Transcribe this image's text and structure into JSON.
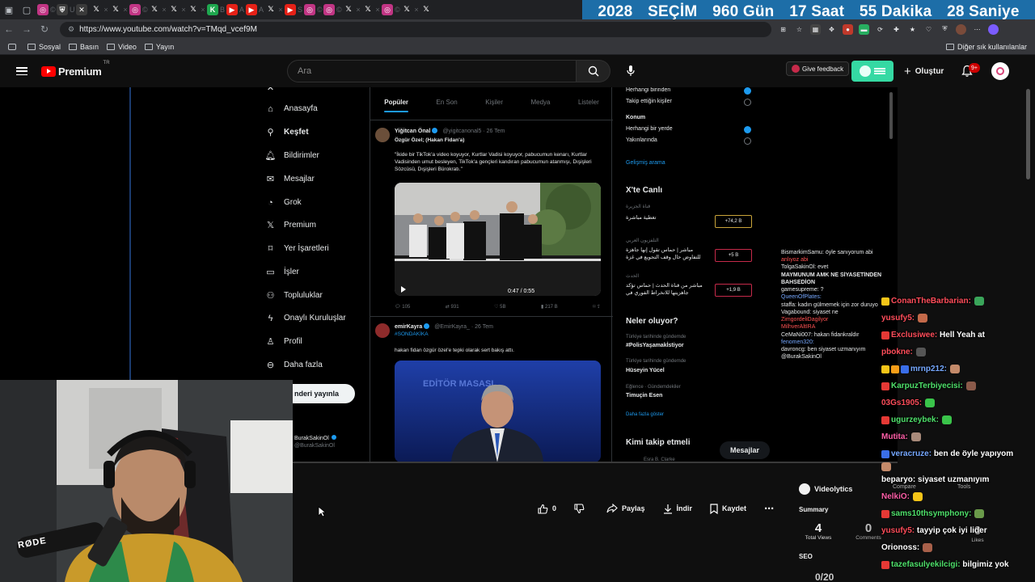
{
  "countdown": {
    "year": "2028",
    "label": "SEÇİM",
    "days": "960 Gün",
    "hours": "17 Saat",
    "minutes": "55 Dakika",
    "seconds": "28 Saniye",
    "bg_color": "#1d6ea8"
  },
  "browser": {
    "url": "https://www.youtube.com/watch?v=TMqd_vcef9M",
    "bookmarks": [
      "Sosyal",
      "Basın",
      "Video",
      "Yayın"
    ],
    "bookmarks_right": "Diğer sık kullanılanlar"
  },
  "youtube": {
    "logo_text": "Premium",
    "logo_region": "TR",
    "search_placeholder": "Ara",
    "feedback_label": "Give feedback",
    "create_label": "Oluştur",
    "notif_count": "9+",
    "accent": "#ff0000"
  },
  "x_screen": {
    "nav": [
      {
        "label": "Anasayfa",
        "icon": "home-icon"
      },
      {
        "label": "Keşfet",
        "icon": "search-icon",
        "bold": true
      },
      {
        "label": "Bildirimler",
        "icon": "bell-icon"
      },
      {
        "label": "Mesajlar",
        "icon": "mail-icon"
      },
      {
        "label": "Grok",
        "icon": "grok-icon"
      },
      {
        "label": "Premium",
        "icon": "x-logo-icon"
      },
      {
        "label": "Yer İşaretleri",
        "icon": "bookmark-icon"
      },
      {
        "label": "İşler",
        "icon": "briefcase-icon"
      },
      {
        "label": "Topluluklar",
        "icon": "people-icon"
      },
      {
        "label": "Onaylı Kuruluşlar",
        "icon": "lightning-icon"
      },
      {
        "label": "Profil",
        "icon": "person-icon"
      },
      {
        "label": "Daha fazla",
        "icon": "more-circle-icon"
      }
    ],
    "post_button": "nderi yayınla",
    "account_name": "BurakSakinOl",
    "account_handle": "@BurakSakinOl",
    "tabs": [
      "Popüler",
      "En Son",
      "Kişiler",
      "Medya",
      "Listeler"
    ],
    "tweet1": {
      "author": "Yiğitcan Önal",
      "meta": "@yigitcanonal5 · 26 Tem",
      "title": "Özgür Özel; (Hakan Fidan'a)",
      "text": "\"İkide bir TikTok'a video koyuyor, Kurtlar Vadisi koyuyor, pabucumun kenarı, Kurtlar Vadisinden umut besleyen, TikTok'a gençleri kandıran pabucumun atanmışı, Dışişleri Sözcüsü, Dışişleri Bürokratı.\"",
      "duration": "0:47 / 0:55",
      "stats": [
        "105",
        "931",
        "5B",
        "217 B"
      ]
    },
    "tweet2": {
      "author": "emirKayra",
      "meta": "@EmirKayra_ · 26 Tem",
      "hashtag": "#SONDAKİKA",
      "text": "hakan fidan özgür özel'e tepki olarak sert bakış attı.",
      "studio_label": "EDİTÖR MASASI"
    },
    "right": {
      "option1": "Herhangi birinden",
      "option2": "Takip ettiğin kişiler",
      "location_header": "Konum",
      "option3": "Herhangi bir yerde",
      "option4": "Yakınlarında",
      "advanced": "Gelişmiş arama",
      "live_header": "X'te Canlı",
      "live": [
        {
          "text": "تغطية مباشرة",
          "source": "قناة الجزيرة",
          "count": "+74,2 B"
        },
        {
          "text": "مباشر | حماس تقول إنها جاهزة للتفاوض حال وقف التجويع في غزة",
          "source": "التلفزيون العربي",
          "count": "+5 B"
        },
        {
          "text": "مباشر من قناة الحدث | حماس تؤكد جاهزيتها للانخراط الفوري في",
          "source": "الحدث",
          "count": "+1,9 B"
        }
      ],
      "whats_header": "Neler oluyor?",
      "trends": [
        {
          "ctx": "Türkiye tarihinde gündemde",
          "name": "#PolisYaşamakİstiyor"
        },
        {
          "ctx": "Türkiye tarihinde gündemde",
          "name": "Hüseyin Yücel"
        },
        {
          "ctx": "Eğlence · Gündemdekiler",
          "name": "Timuçin Esen"
        }
      ],
      "show_more": "Daha fazla göster",
      "follow_header": "Kimi takip etmeli",
      "follow_name": "Esra B. Clarke"
    },
    "messages_pill": "Mesajlar",
    "chat": [
      "BismarkimSamu: öyle sanıyorum abi",
      "anlıyoz abi",
      "TolgaSakinOl: evet",
      "MAYMUNUM AMK NE SİYASETİNDEN BAHSEDİON",
      "gamesupreme: ?",
      "QueenOfPlates:",
      "staffa: kadın gülmemek için zor duruyo",
      "Vagabound: siyaset ne",
      "ZimgordeliDagilyor",
      "MilhverAltIRA",
      "CeMaNi007: hakan fidankraldır",
      "fenomen320:",
      "davroncg: ben siyaset uzmanıyım",
      "@BurakSakinOl"
    ]
  },
  "video_actions": {
    "likes": "0",
    "share": "Paylaş",
    "download": "İndir",
    "save": "Kaydet"
  },
  "videolytics": {
    "title": "Videolytics",
    "summary": "Summary",
    "views_value": "4",
    "views_label": "Total Views",
    "comments_value": "0",
    "comments_label": "Comments",
    "likes_value": "0",
    "likes_label": "Likes",
    "seo": "SEO",
    "score": "0/20",
    "compare": "Compare",
    "tools": "Tools"
  },
  "stream_chat": [
    {
      "user": "ConanTheBarbarian:",
      "msg": "",
      "color": "red"
    },
    {
      "user": "yusufy5:",
      "msg": "",
      "color": "red"
    },
    {
      "user": "Exclusiwee:",
      "msg": "Hell Yeah at",
      "color": "red"
    },
    {
      "user": "pbokne:",
      "msg": "",
      "color": "red"
    },
    {
      "user": "mrnp212:",
      "msg": "",
      "color": "blue"
    },
    {
      "user": "KarpuzTerbiyecisi:",
      "msg": "",
      "color": "green"
    },
    {
      "user": "03Gs1905:",
      "msg": "",
      "color": "red"
    },
    {
      "user": "ugurzeybek:",
      "msg": "",
      "color": "green"
    },
    {
      "user": "Mutita:",
      "msg": "",
      "color": "pink"
    },
    {
      "user": "veracruze:",
      "msg": "ben de öyle yapıyom",
      "color": "blue"
    },
    {
      "user": "",
      "msg": "",
      "color": "white"
    },
    {
      "user": "beparyo:",
      "msg": "siyaset uzmanıyım",
      "color": "white"
    },
    {
      "user": "NelkiO:",
      "msg": "",
      "color": "pink"
    },
    {
      "user": "sams10thsymphony:",
      "msg": "",
      "color": "green"
    },
    {
      "user": "yusufy5:",
      "msg": "tayyip çok iyi lider",
      "color": "red"
    },
    {
      "user": "Orionoss:",
      "msg": "",
      "color": "white"
    },
    {
      "user": "tazefasulyekilcigi:",
      "msg": "bilgimiz yok",
      "color": "green"
    }
  ],
  "webcam": {
    "mic_brand": "RØDE"
  }
}
